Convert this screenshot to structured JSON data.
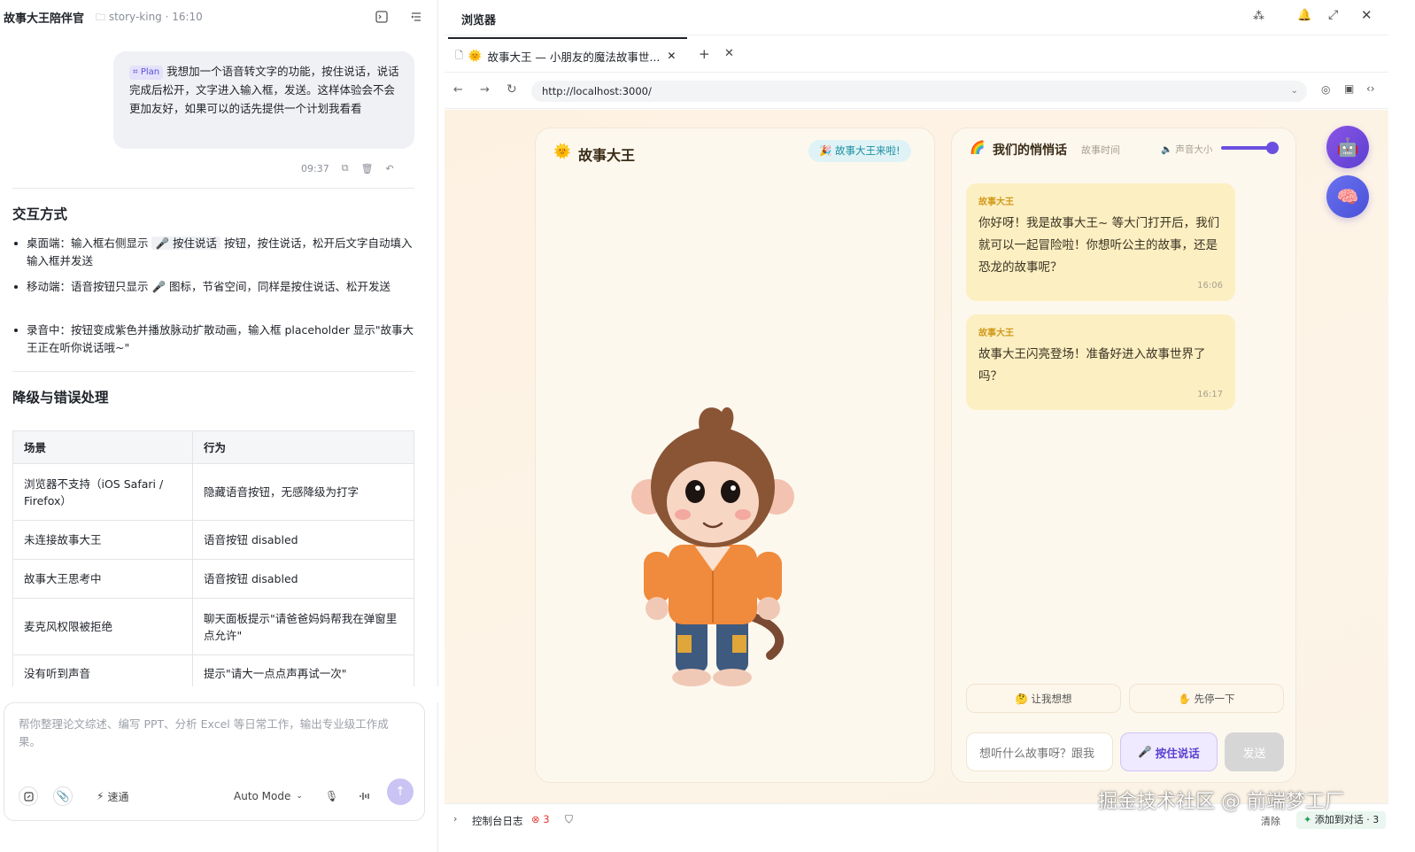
{
  "left_panel": {
    "app_title": "故事大王陪伴官",
    "folder": "story-king · 16:10",
    "user_message": {
      "badge": "Plan",
      "text": "我想加一个语音转文字的功能，按住说话，说话完成后松开，文字进入输入框，发送。这样体验会不会更加友好，如果可以的话先提供一个计划我看看",
      "time": "09:37"
    },
    "section1_title": "交互方式",
    "bullets": [
      {
        "pre": "桌面端：输入框右侧显示 ",
        "code": "🎤 按住说话",
        "post": " 按钮，按住说话，松开后文字自动填入输入框并发送"
      },
      {
        "pre": "移动端：语音按钮只显示 🎤 图标，节省空间，同样是按住说话、松开发送",
        "code": "",
        "post": ""
      },
      {
        "pre": "录音中：按钮变成紫色并播放脉动扩散动画，输入框 placeholder 显示\"故事大王正在听你说话哦~\"",
        "code": "",
        "post": ""
      }
    ],
    "section2_title": "降级与错误处理",
    "table": {
      "headers": [
        "场景",
        "行为"
      ],
      "rows": [
        [
          "浏览器不支持（iOS Safari / Firefox）",
          "隐藏语音按钮，无感降级为打字"
        ],
        [
          "未连接故事大王",
          "语音按钮 disabled"
        ],
        [
          "故事大王思考中",
          "语音按钮 disabled"
        ],
        [
          "麦克风权限被拒绝",
          "聊天面板提示\"请爸爸妈妈帮我在弹窗里点允许\""
        ],
        [
          "没有听到声音",
          "提示\"请大一点点声再试一次\""
        ]
      ]
    },
    "composer": {
      "placeholder": "帮你整理论文综述、编写 PPT、分析 Excel 等日常工作，输出专业级工作成果。",
      "speed_label": "速通",
      "mode_label": "Auto Mode"
    }
  },
  "browser": {
    "title": "浏览器",
    "tab_title": "故事大王 — 小朋友的魔法故事世...",
    "url": "http://localhost:3000/",
    "console_label": "控制台日志",
    "error_count": "3",
    "clear_label": "清除",
    "add_to_chat_label": "添加到对话 · 3"
  },
  "app": {
    "left_card_title": "故事大王",
    "status_badge": "🎉 故事大王来啦!",
    "chat_title": "我们的悄悄话",
    "chat_subtitle": "故事时间",
    "volume_label": "声音大小",
    "volume_level": 0.88,
    "messages": [
      {
        "sender": "故事大王",
        "text": "你好呀！我是故事大王~ 等大门打开后，我们就可以一起冒险啦！你想听公主的故事，还是恐龙的故事呢？",
        "time": "16:06"
      },
      {
        "sender": "故事大王",
        "text": "故事大王闪亮登场！准备好进入故事世界了吗？",
        "time": "16:17"
      }
    ],
    "quick_actions": [
      "🤔 让我想想",
      "✋ 先停一下"
    ],
    "input_placeholder": "想听什么故事呀？跟我",
    "mic_label": "按住说话",
    "send_label": "发送"
  },
  "watermark": "掘金技术社区 @ 前端梦工厂",
  "colors": {
    "accent": "#6b4fe0",
    "bubble": "#fcefc2",
    "error": "#e53935"
  }
}
